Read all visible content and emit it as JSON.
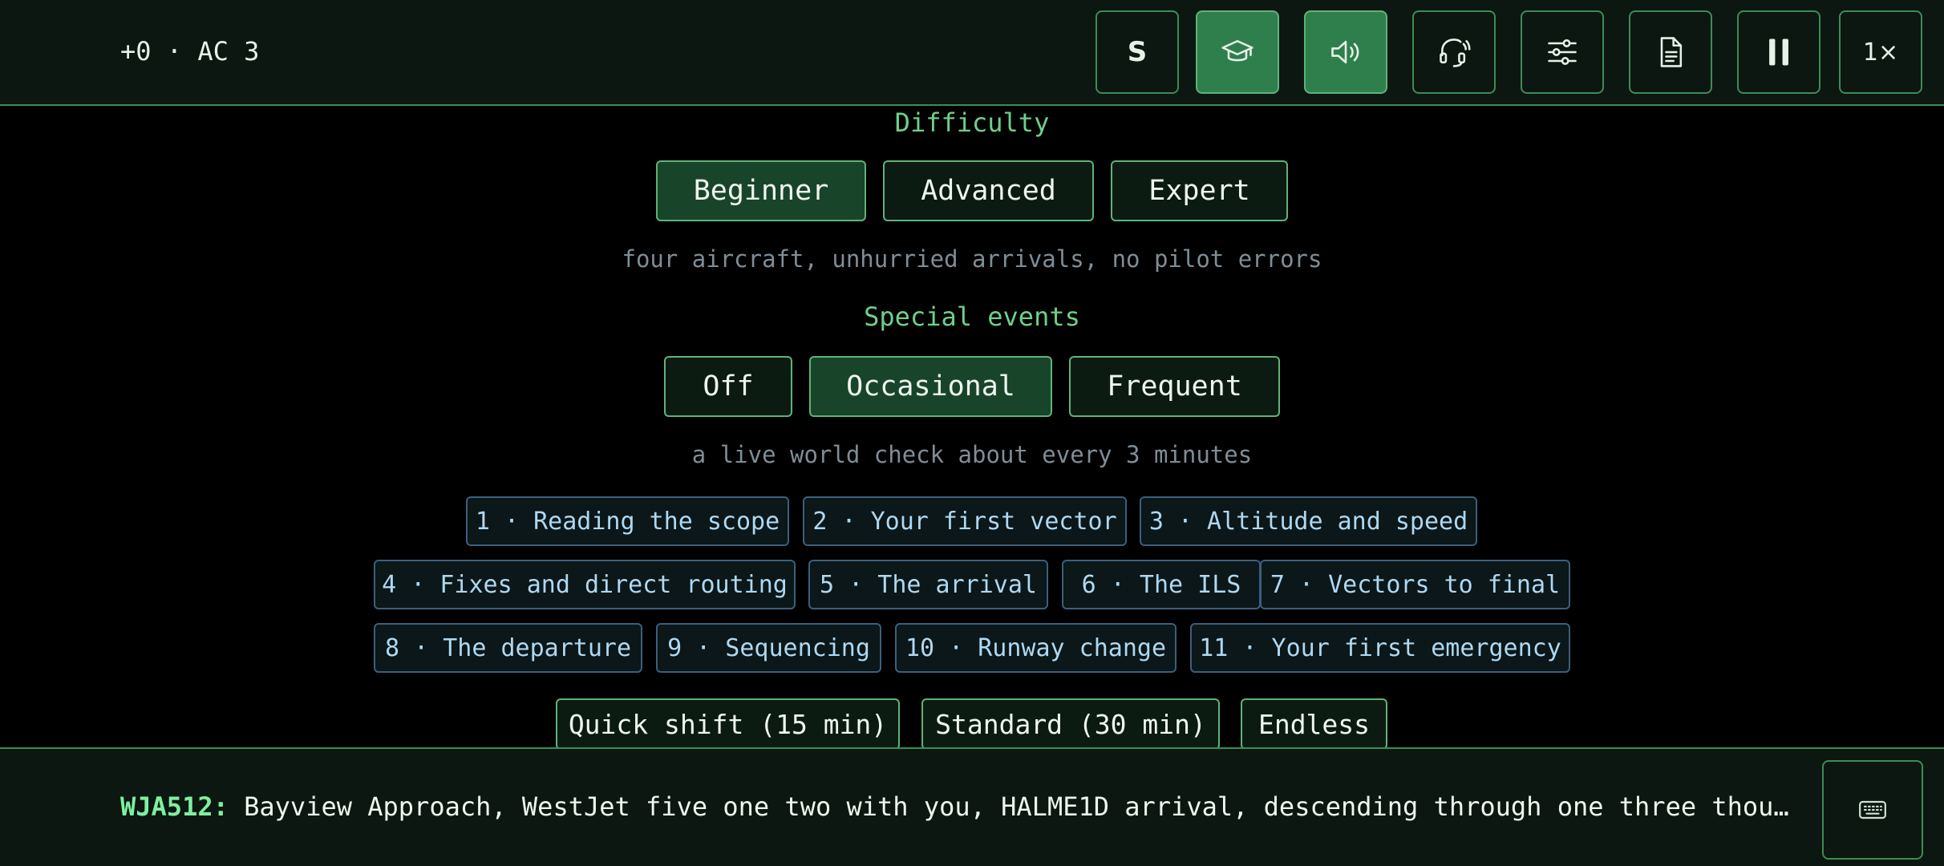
{
  "status": {
    "score": "+0",
    "separator": "·",
    "aircraft_count": "AC 3"
  },
  "toolbar": {
    "s_label": "S",
    "speed_label": "1×",
    "tools": [
      {
        "icon": "graduation-cap-icon",
        "active": true
      },
      {
        "icon": "speaker-icon",
        "active": true
      },
      {
        "icon": "headset-icon",
        "active": false
      },
      {
        "icon": "sliders-icon",
        "active": false
      },
      {
        "icon": "document-icon",
        "active": false
      },
      {
        "icon": "pause-icon",
        "active": false
      }
    ]
  },
  "difficulty": {
    "label": "Difficulty",
    "options": [
      "Beginner",
      "Advanced",
      "Expert"
    ],
    "selected": "Beginner",
    "hint": "four aircraft, unhurried arrivals, no pilot errors"
  },
  "special_events": {
    "label": "Special events",
    "options": [
      "Off",
      "Occasional",
      "Frequent"
    ],
    "selected": "Occasional",
    "hint": "a live world check about every 3 minutes"
  },
  "lessons": [
    "1 · Reading the scope",
    "2 · Your first vector",
    "3 · Altitude and speed",
    "4 · Fixes and direct routing",
    "5 · The arrival",
    "6 · The ILS",
    "7 · Vectors to final",
    "8 · The departure",
    "9 · Sequencing",
    "10 · Runway change",
    "11 · Your first emergency"
  ],
  "shifts": [
    "Quick shift (15 min)",
    "Standard (30 min)",
    "Endless"
  ],
  "radio": {
    "callsign": "WJA512:",
    "message": "Bayview Approach, WestJet five one two with you, HALME1D arrival, descending through one three thousand"
  },
  "colors": {
    "accent": "#3f8a58",
    "active_tool": "#2f7f4d",
    "section_label": "#6fcf8a",
    "lesson_text": "#aed8f2",
    "callsign": "#7ef0a0"
  }
}
